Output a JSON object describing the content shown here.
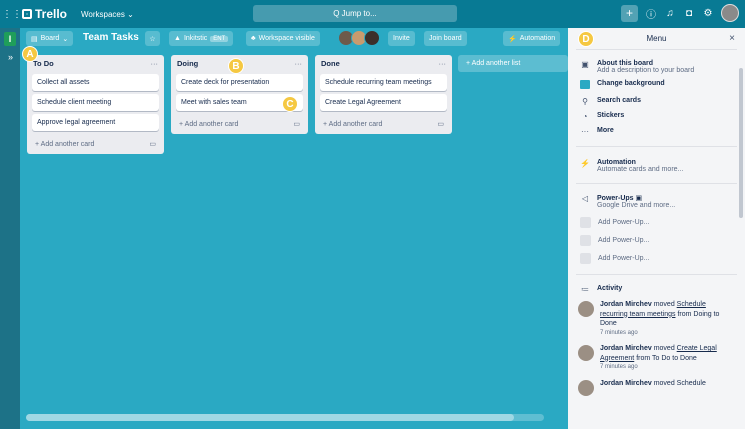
{
  "topbar": {
    "app_name": "Trello",
    "workspaces_label": "Workspaces",
    "search_placeholder": "Q Jump to..."
  },
  "board": {
    "sidebar_initial": "I",
    "view_label": "Board",
    "title": "Team Tasks",
    "workspace_name": "Inkitstic",
    "workspace_badge": "ENT",
    "visibility_label": "Workspace visible",
    "invite_label": "Invite",
    "join_label": "Join board",
    "automation_label": "Automation"
  },
  "lists": [
    {
      "title": "To Do",
      "cards": [
        "Collect all assets",
        "Schedule client meeting",
        "Approve legal agreement"
      ],
      "add_card": "+ Add another card"
    },
    {
      "title": "Doing",
      "cards": [
        "Create deck for presentation",
        "Meet with sales team"
      ],
      "add_card": "+ Add another card"
    },
    {
      "title": "Done",
      "cards": [
        "Schedule recurring team meetings",
        "Create Legal Agreement"
      ],
      "add_card": "+ Add another card"
    }
  ],
  "add_list_label": "+ Add another list",
  "menu": {
    "title": "Menu",
    "about_title": "About this board",
    "about_sub": "Add a description to your board",
    "change_bg": "Change background",
    "search_cards": "Search cards",
    "stickers": "Stickers",
    "more": "More",
    "automation_title": "Automation",
    "automation_sub": "Automate cards and more...",
    "powerups_title": "Power-Ups",
    "powerups_sub": "Google Drive and more...",
    "add_powerup": "Add Power-Up...",
    "activity_title": "Activity",
    "activities": [
      {
        "user": "Jordan Mirchev",
        "action": "moved",
        "item": "Schedule recurring team meetings",
        "from": "from Doing to",
        "to": "Done",
        "time": "7 minutes ago"
      },
      {
        "user": "Jordan Mirchev",
        "action": "moved",
        "item": "Create Legal Agreement",
        "from": "from To Do to Done",
        "to": "",
        "time": "7 minutes ago"
      },
      {
        "user": "Jordan Mirchev",
        "action": "moved Schedule",
        "item": "",
        "from": "",
        "to": "",
        "time": ""
      }
    ]
  },
  "markers": {
    "a": "A",
    "b": "B",
    "c": "C",
    "d": "D"
  },
  "colors": {
    "board_bg": "#2aa9c3",
    "topbar": "#087a94",
    "marker": "#f5c842"
  }
}
